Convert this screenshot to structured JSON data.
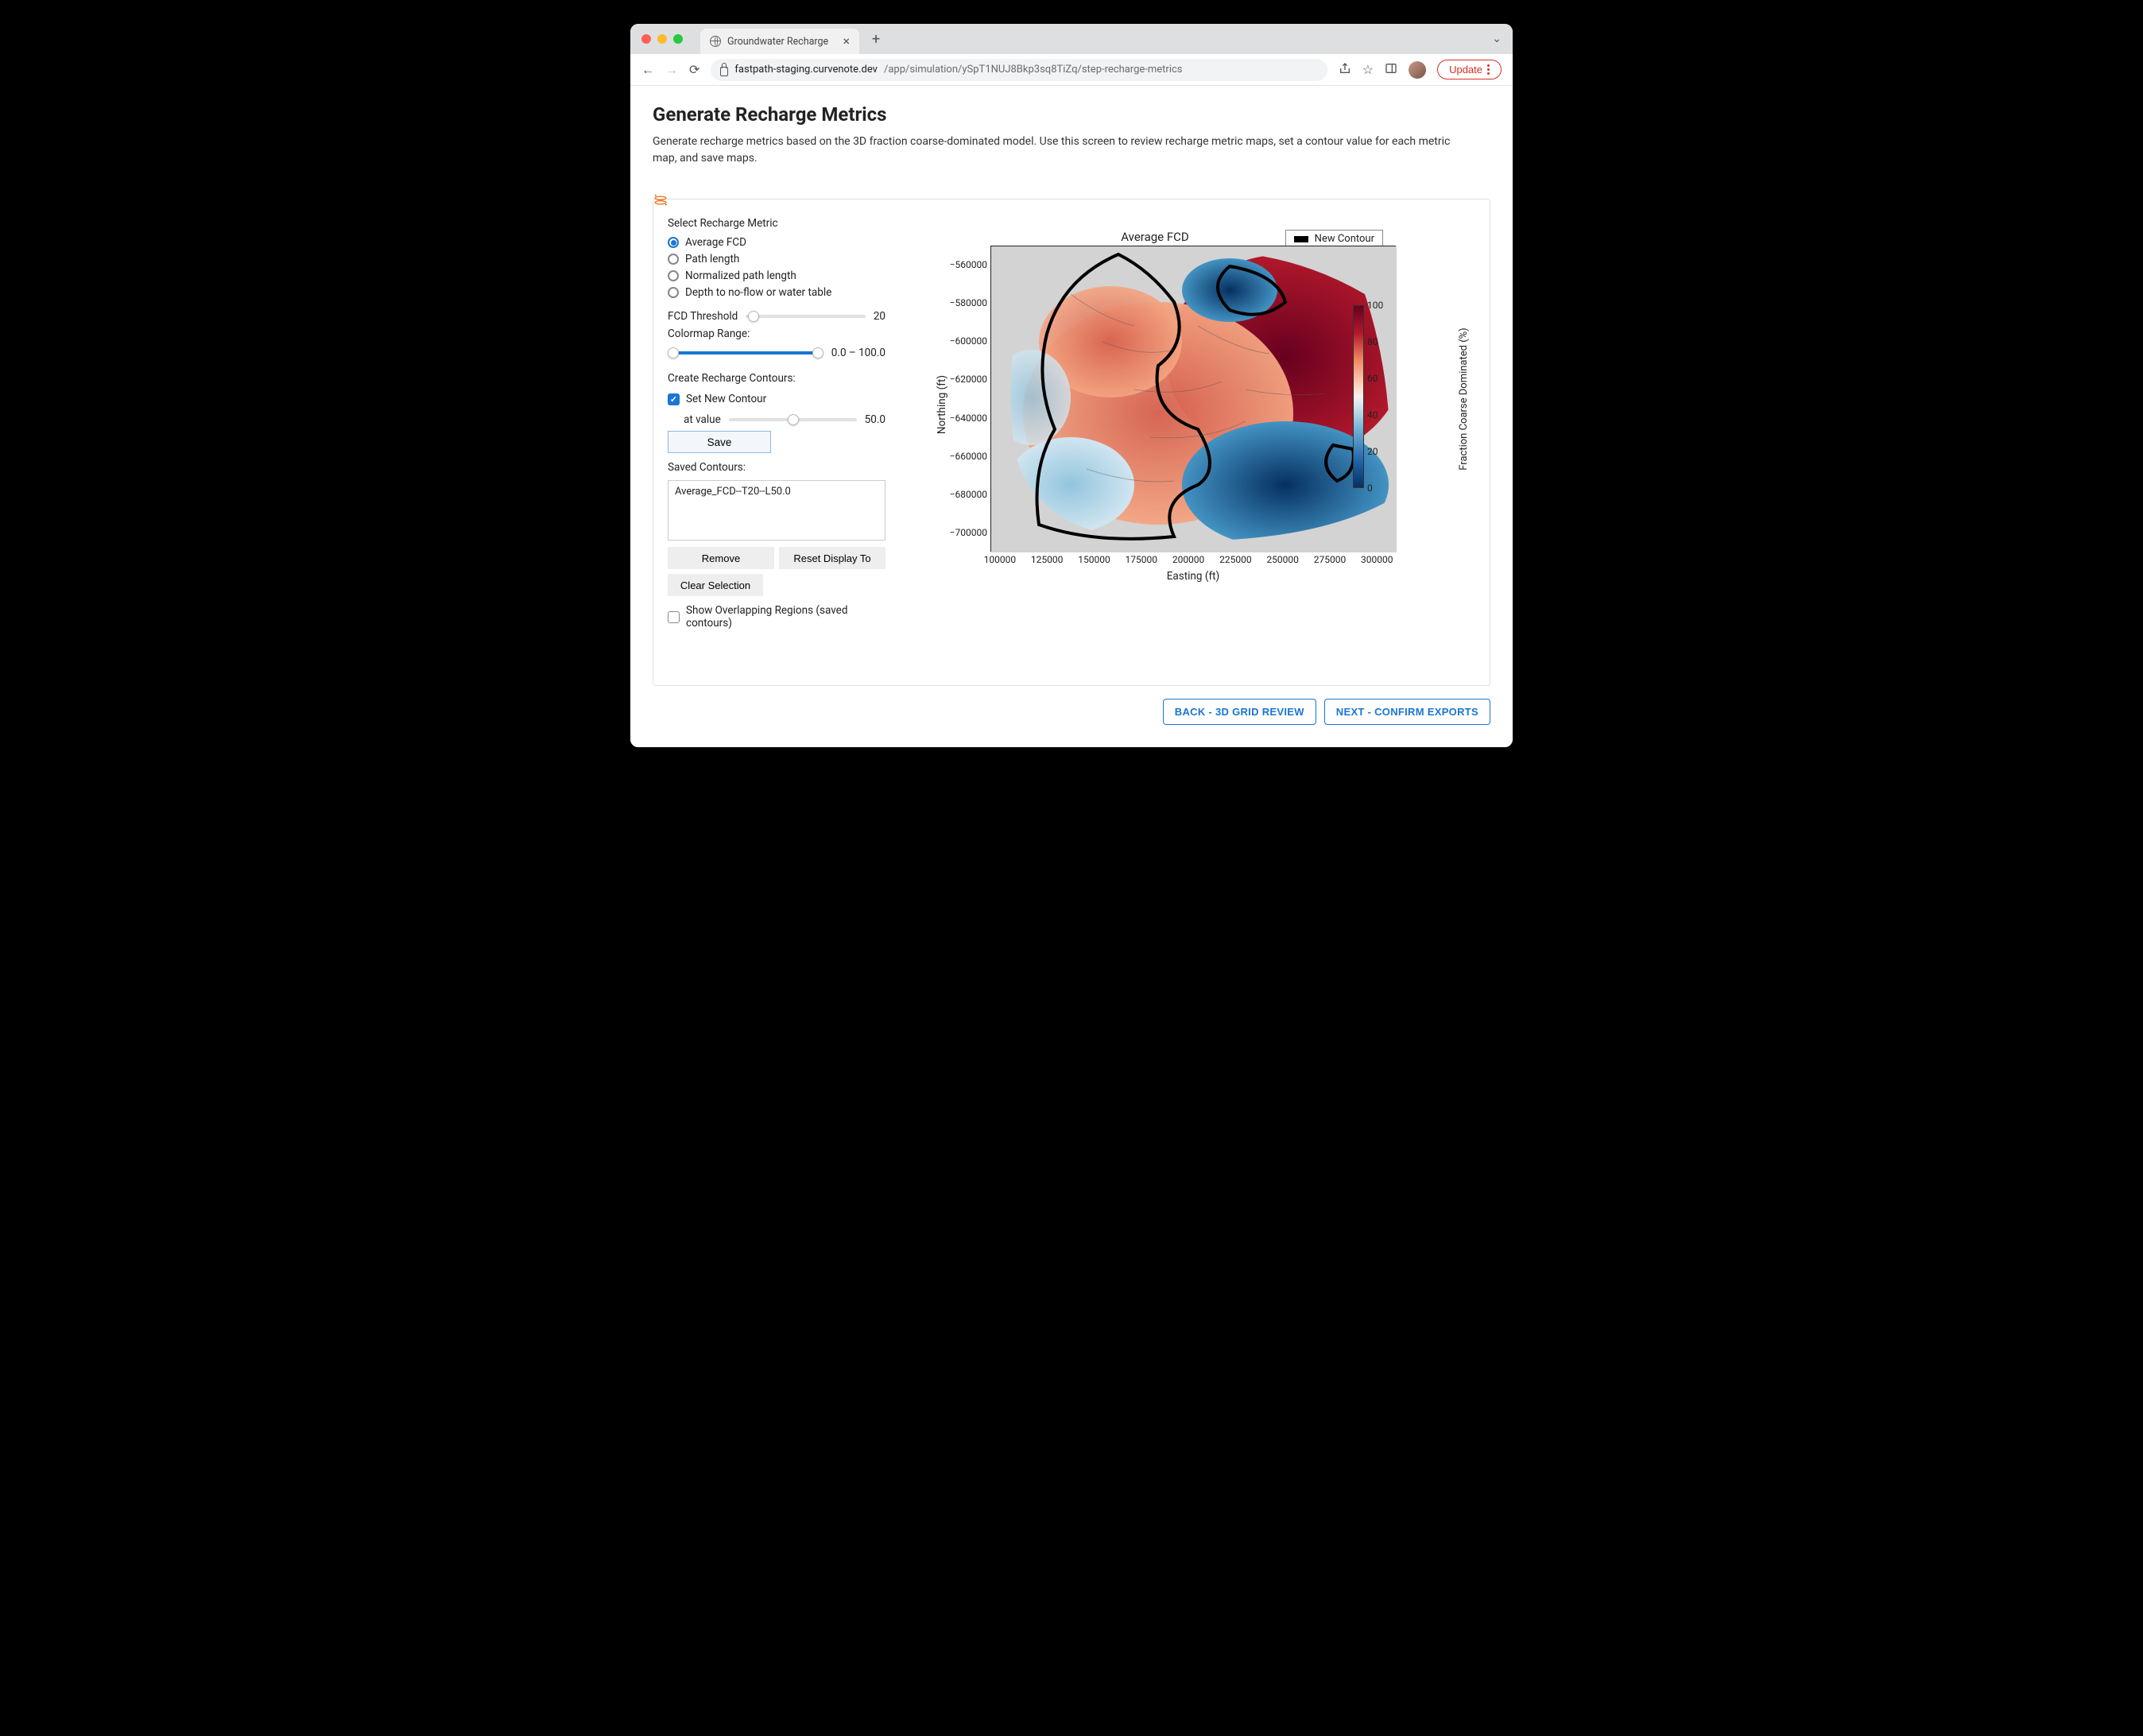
{
  "browser": {
    "tab_title": "Groundwater Recharge",
    "url_host": "fastpath-staging.curvenote.dev",
    "url_path": "/app/simulation/ySpT1NUJ8Bkp3sq8TiZq/step-recharge-metrics",
    "update_label": "Update"
  },
  "page": {
    "title": "Generate Recharge Metrics",
    "description": "Generate recharge metrics based on the 3D fraction coarse-dominated model. Use this screen to review recharge metric maps, set a contour value for each metric map, and save maps."
  },
  "controls": {
    "select_metric_label": "Select Recharge Metric",
    "metrics": [
      {
        "label": "Average FCD",
        "checked": true
      },
      {
        "label": "Path length",
        "checked": false
      },
      {
        "label": "Normalized path length",
        "checked": false
      },
      {
        "label": "Depth to no-flow or water table",
        "checked": false
      }
    ],
    "fcd_threshold_label": "FCD Threshold",
    "fcd_threshold_value": "20",
    "colormap_label": "Colormap Range:",
    "colormap_value": "0.0 – 100.0",
    "contours_label": "Create Recharge Contours:",
    "set_new_contour_label": "Set New Contour",
    "set_new_contour_checked": true,
    "at_value_label": "at value",
    "at_value_value": "50.0",
    "save_btn": "Save",
    "saved_label": "Saved Contours:",
    "saved_items": [
      "Average_FCD--T20--L50.0"
    ],
    "remove_btn": "Remove",
    "reset_btn": "Reset Display To",
    "clear_btn": "Clear Selection",
    "overlap_label": "Show Overlapping Regions (saved contours)",
    "overlap_checked": false
  },
  "chart_data": {
    "type": "heatmap",
    "title": "Average FCD",
    "xlabel": "Easting (ft)",
    "ylabel": "Northing (ft)",
    "legend": "New Contour",
    "x_ticks": [
      100000,
      125000,
      150000,
      175000,
      200000,
      225000,
      250000,
      275000,
      300000
    ],
    "y_ticks": [
      -560000,
      -580000,
      -600000,
      -620000,
      -640000,
      -660000,
      -680000,
      -700000
    ],
    "x_range": [
      95000,
      310000
    ],
    "y_range": [
      -710000,
      -550000
    ],
    "colorbar": {
      "label": "Fraction Coarse Dominated (%)",
      "ticks": [
        0,
        20,
        40,
        60,
        80,
        100
      ],
      "range": [
        0,
        100
      ],
      "cmap": "RdBu_r"
    },
    "contour_at": 50.0,
    "note": "Irregular geospatial raster; values range 0–100. Dark red ≈ high FCD (80–100), dark blue ≈ low FCD (0–20). Black outline = New Contour at 50.0."
  },
  "nav": {
    "back": "BACK - 3D GRID REVIEW",
    "next": "NEXT - CONFIRM EXPORTS"
  }
}
